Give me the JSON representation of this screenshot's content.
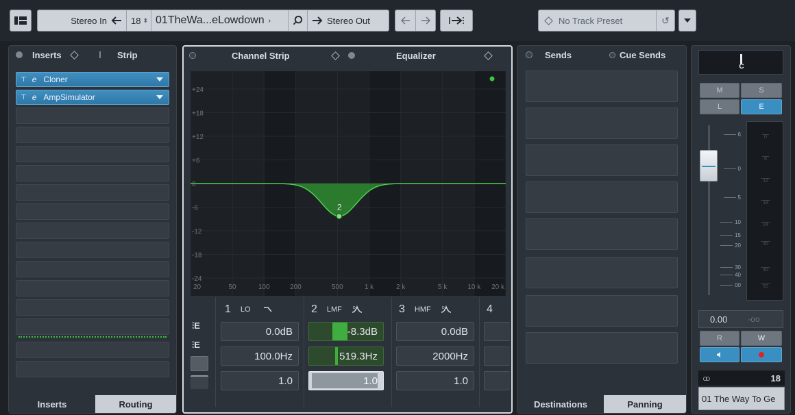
{
  "toolbar": {
    "input_label": "Stereo In",
    "channel_number": "18",
    "channel_name": "01TheWa...eLowdown",
    "output_label": "Stereo Out",
    "preset_label": "No Track Preset"
  },
  "inserts_panel": {
    "tab_inserts": "Inserts",
    "tab_strip": "Strip",
    "plugins": [
      {
        "label": "Cloner"
      },
      {
        "label": "AmpSimulator"
      }
    ],
    "bottom_tab_inserts": "Inserts",
    "bottom_tab_routing": "Routing"
  },
  "eq_panel": {
    "tab_channel_strip": "Channel Strip",
    "tab_equalizer": "Equalizer",
    "db_labels": [
      "+24",
      "+18",
      "+12",
      "+6",
      "0",
      "-6",
      "-12",
      "-18",
      "-24"
    ],
    "freq_labels": [
      "20",
      "50",
      "100",
      "200",
      "500",
      "1 k",
      "2 k",
      "5 k",
      "10 k",
      "20 k"
    ],
    "node_label": "2",
    "curve": {
      "center_hz": 519.3,
      "gain_db": -8.3
    },
    "bands": [
      {
        "num": "1",
        "type": "LO",
        "gain": "0.0dB",
        "freq": "100.0Hz",
        "q": "1.0"
      },
      {
        "num": "2",
        "type": "LMF",
        "gain": "-8.3dB",
        "freq": "519.3Hz",
        "q": "1.0"
      },
      {
        "num": "3",
        "type": "HMF",
        "gain": "0.0dB",
        "freq": "2000Hz",
        "q": "1.0"
      },
      {
        "num": "4",
        "type": "",
        "gain": "",
        "freq": "",
        "q": ""
      }
    ]
  },
  "sends_panel": {
    "tab_sends": "Sends",
    "tab_cue_sends": "Cue Sends",
    "bottom_tab_destinations": "Destinations",
    "bottom_tab_panning": "Panning"
  },
  "channel_strip": {
    "pan_label": "C",
    "btn_m": "M",
    "btn_s": "S",
    "btn_l": "L",
    "btn_e": "E",
    "fader_scale": [
      "6",
      "0",
      "5",
      "10",
      "15",
      "20",
      "30",
      "40",
      "00"
    ],
    "meter_scale": [
      "0",
      "6",
      "12",
      "18",
      "24",
      "30",
      "40",
      "50"
    ],
    "volume_value": "0.00",
    "peak_value": "-oo",
    "btn_r": "R",
    "btn_w": "W",
    "channel_number": "18",
    "track_name": "01 The Way To Ge"
  },
  "colors": {
    "accent_blue": "#3a8fc2",
    "eq_green": "#2f8a2f",
    "record_red": "#e02424"
  }
}
